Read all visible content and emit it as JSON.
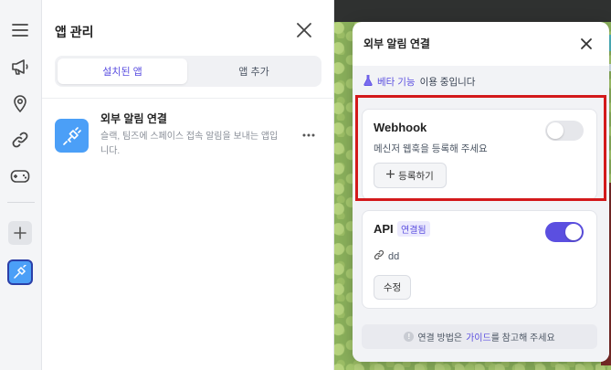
{
  "rail": {
    "icons": [
      "menu-icon",
      "megaphone-icon",
      "location-pin-icon",
      "link-icon",
      "gamepad-icon",
      "add-icon",
      "integration-app-icon"
    ]
  },
  "app_panel": {
    "title": "앱 관리",
    "tabs": [
      {
        "label": "설치된 앱",
        "active": true
      },
      {
        "label": "앱 추가",
        "active": false
      }
    ],
    "apps": [
      {
        "name": "외부 알림 연결",
        "description": "슬랙, 팀즈에 스페이스 접속 알림을 보내는 앱입니다."
      }
    ]
  },
  "popup": {
    "title": "외부 알림 연결",
    "beta_highlight": "베타 기능",
    "beta_rest": "이용 중입니다",
    "webhook": {
      "title": "Webhook",
      "subtitle": "메신저 웹훅을 등록해 주세요",
      "enabled": false,
      "register_label": "등록하기"
    },
    "api": {
      "title": "API",
      "badge": "연결됨",
      "link_text": "dd",
      "enabled": true,
      "edit_label": "수정"
    },
    "guide": {
      "prefix": "연결 방법은",
      "link": "가이드",
      "suffix": "를 참고해 주세요"
    }
  },
  "colors": {
    "accent": "#5b4fe0",
    "app_icon_bg": "#4b9ff7",
    "highlight": "#d3191b"
  }
}
